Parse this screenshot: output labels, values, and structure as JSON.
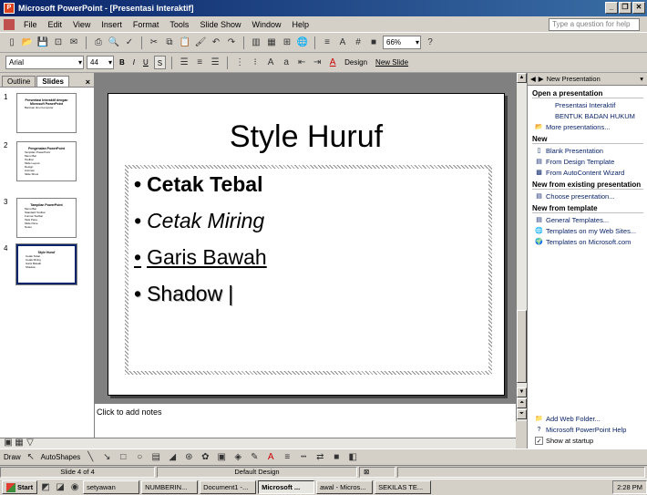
{
  "window": {
    "title": "Microsoft PowerPoint - [Presentasi Interaktif]",
    "controls": [
      "_",
      "❐",
      "✕"
    ]
  },
  "menubar": {
    "items": [
      "File",
      "Edit",
      "View",
      "Insert",
      "Format",
      "Tools",
      "Slide Show",
      "Window",
      "Help"
    ],
    "question_placeholder": "Type a question for help"
  },
  "toolbar1": {
    "zoom": "66%"
  },
  "toolbar2": {
    "font": "Arial",
    "size": "44",
    "bold": "B",
    "italic": "I",
    "underline": "U",
    "shadow": "S",
    "design": "Design",
    "new_slide": "New Slide"
  },
  "left_pane": {
    "tabs": [
      "Outline",
      "Slides"
    ],
    "close": "×",
    "slides": [
      {
        "num": "1",
        "title": "Presentasi Interaktif dengan Microsoft PowerPoint",
        "lines": [
          "Bantuan Ilmu Komputer"
        ]
      },
      {
        "num": "2",
        "title": "Pengenalan PowerPoint",
        "lines": [
          "Tampilan PowerPoint",
          "Menu Bar",
          "Toolbar",
          "Slide Layout",
          "Design",
          "Animasi",
          "Slide Show"
        ]
      },
      {
        "num": "3",
        "title": "Tampilan PowerPoint",
        "lines": [
          "Menu Bar",
          "Standard Toolbar",
          "Format Toolbar",
          "Task Pane",
          "Slide Pane",
          "Notes"
        ]
      },
      {
        "num": "4",
        "title": "Style Huruf",
        "lines": [
          "Cetak Tebal",
          "Cetak Miring",
          "Garis Bawah",
          "Shadow"
        ]
      }
    ]
  },
  "slide": {
    "title": "Style Huruf",
    "bullets": [
      "Cetak Tebal",
      "Cetak Miring",
      "Garis Bawah",
      "Shadow"
    ]
  },
  "notes": {
    "placeholder": "Click to add notes"
  },
  "task_pane": {
    "header": "New Presentation",
    "sections": [
      {
        "title": "Open a presentation",
        "items": [
          "Presentasi Interaktif",
          "BENTUK BADAN HUKUM",
          "More presentations..."
        ]
      },
      {
        "title": "New",
        "items": [
          "Blank Presentation",
          "From Design Template",
          "From AutoContent Wizard"
        ]
      },
      {
        "title": "New from existing presentation",
        "items": [
          "Choose presentation..."
        ]
      },
      {
        "title": "New from template",
        "items": [
          "General Templates...",
          "Templates on my Web Sites...",
          "Templates on Microsoft.com"
        ]
      }
    ],
    "bottom": [
      "Add Web Folder...",
      "Microsoft PowerPoint Help",
      "Show at startup"
    ]
  },
  "drawbar": {
    "draw": "Draw",
    "autoshapes": "AutoShapes"
  },
  "status": {
    "slide": "Slide 4 of 4",
    "design": "Default Design"
  },
  "taskbar": {
    "start": "Start",
    "tasks": [
      "setyawan",
      "NUMBERIN...",
      "Document1 -...",
      "Microsoft ...",
      "awal - Micros...",
      "SEKILAS TE..."
    ],
    "clock": "2:28 PM"
  }
}
